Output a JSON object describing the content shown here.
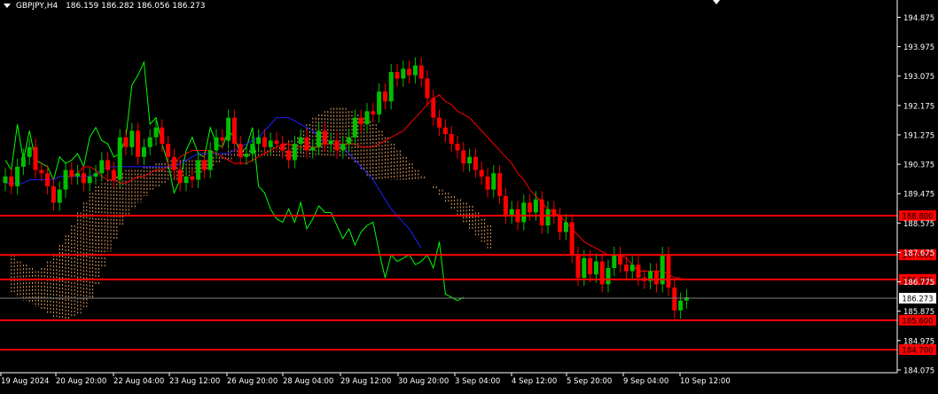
{
  "window": {
    "symbol": "GBPJPY,H4",
    "ohlc": "186.159 186.282 186.056 186.273"
  },
  "chart_data": {
    "type": "candlestick",
    "symbol": "GBPJPY",
    "timeframe": "H4",
    "ylim": [
      183.8,
      195.6
    ],
    "grid": false,
    "price_ticks": [
      "194.875",
      "193.975",
      "193.075",
      "192.175",
      "191.275",
      "190.375",
      "189.475",
      "188.575",
      "187.675",
      "186.775",
      "185.875",
      "184.975",
      "184.075"
    ],
    "time_labels": [
      "19 Aug 2024",
      "20 Aug 20:00",
      "22 Aug 04:00",
      "23 Aug 12:00",
      "26 Aug 20:00",
      "28 Aug 04:00",
      "29 Aug 12:00",
      "30 Aug 20:00",
      "3 Sep 04:00",
      "4 Sep 12:00",
      "5 Sep 20:00",
      "9 Sep 04:00",
      "10 Sep 12:00"
    ],
    "current_price": "186.273",
    "levels": [
      {
        "label": "188.800",
        "price": 188.8
      },
      {
        "label": "187.600",
        "price": 187.6
      },
      {
        "label": "186.850",
        "price": 186.85
      },
      {
        "label": "185.600",
        "price": 185.6
      },
      {
        "label": "184.700",
        "price": 184.7
      }
    ],
    "colors": {
      "background": "#000000",
      "bull": "#00c000",
      "bear": "#ff0000",
      "tenkan": "#ff0000",
      "kijun": "#2020ff",
      "chikou": "#00ff00",
      "cloud": "#e8a060",
      "level": "#ff0000",
      "axis": "#ffffff"
    },
    "closes": [
      190.0,
      189.7,
      190.3,
      190.6,
      190.9,
      190.2,
      190.1,
      189.7,
      189.2,
      189.6,
      190.2,
      190.0,
      190.1,
      189.8,
      190.0,
      190.1,
      190.5,
      190.2,
      189.9,
      191.2,
      190.9,
      191.4,
      190.6,
      190.9,
      191.2,
      191.5,
      191.0,
      190.6,
      190.2,
      189.8,
      190.0,
      189.9,
      190.5,
      190.2,
      190.8,
      191.2,
      191.1,
      191.8,
      191.0,
      190.6,
      190.7,
      191.0,
      191.2,
      190.9,
      191.1,
      191.0,
      190.8,
      190.5,
      191.0,
      191.2,
      190.8,
      190.9,
      191.4,
      191.0,
      191.1,
      190.8,
      191.0,
      191.2,
      191.8,
      191.6,
      192.0,
      191.9,
      192.6,
      192.3,
      193.2,
      193.0,
      193.3,
      193.1,
      193.4,
      193.0,
      192.4,
      191.8,
      191.5,
      191.3,
      191.0,
      190.8,
      190.4,
      190.6,
      190.2,
      190.0,
      189.6,
      190.1,
      189.4,
      188.8,
      189.0,
      188.6,
      189.2,
      188.9,
      189.3,
      188.5,
      189.0,
      188.8,
      188.3,
      188.6,
      187.6,
      186.9,
      187.5,
      187.0,
      187.4,
      186.7,
      187.2,
      187.6,
      187.3,
      187.1,
      187.3,
      186.9,
      186.8,
      187.1,
      186.7,
      187.6,
      186.6,
      185.9,
      186.2,
      186.3
    ],
    "tenkan": [
      190.0,
      190.0,
      190.1,
      190.3,
      190.3,
      190.2,
      190.0,
      189.9,
      189.9,
      189.8,
      189.8,
      189.9,
      190.0,
      190.0,
      190.1,
      190.2,
      190.2,
      190.3,
      190.4,
      190.6,
      190.7,
      190.8,
      190.8,
      190.8,
      190.8,
      190.7,
      190.6,
      190.5,
      190.4,
      190.4,
      190.4,
      190.5,
      190.6,
      190.7,
      190.8,
      190.9,
      191.0,
      191.0,
      190.9,
      190.9,
      190.9,
      190.9,
      190.9,
      191.0,
      191.0,
      191.0,
      191.0,
      191.0,
      191.0,
      190.9,
      190.9,
      190.9,
      191.0,
      191.1,
      191.2,
      191.3,
      191.4,
      191.6,
      191.8,
      192.0,
      192.2,
      192.4,
      192.5,
      192.3,
      192.2,
      192.0,
      191.9,
      191.8,
      191.6,
      191.4,
      191.2,
      191.0,
      190.8,
      190.6,
      190.4,
      190.1,
      189.9,
      189.6,
      189.4,
      189.2,
      189.0,
      188.9,
      188.8,
      188.6,
      188.4,
      188.2,
      188.0,
      187.9,
      187.8,
      187.7,
      187.6,
      187.6,
      187.6,
      187.5,
      187.3,
      187.1,
      187.1,
      187.1,
      187.1,
      187.1,
      187.0,
      186.9,
      186.9
    ],
    "kijun": [
      189.8,
      189.8,
      189.8,
      189.8,
      189.9,
      189.9,
      189.9,
      189.9,
      189.9,
      190.0,
      190.0,
      190.0,
      190.0,
      190.0,
      190.0,
      190.1,
      190.2,
      190.3,
      190.3,
      190.3,
      190.3,
      190.3,
      190.3,
      190.3,
      190.3,
      190.3,
      190.3,
      190.3,
      190.3,
      190.4,
      190.5,
      190.6,
      190.7,
      190.7,
      190.7,
      190.7,
      190.7,
      190.7,
      190.8,
      190.9,
      191.0,
      191.1,
      191.2,
      191.4,
      191.6,
      191.8,
      191.8,
      191.8,
      191.7,
      191.6,
      191.5,
      191.4,
      191.2,
      191.0,
      191.0,
      191.0,
      190.9,
      190.7,
      190.5,
      190.3,
      190.1,
      189.9,
      189.6,
      189.3,
      189.0,
      188.8,
      188.6,
      188.4,
      188.1,
      187.8
    ],
    "chikou": [
      190.5,
      190.2,
      191.6,
      190.5,
      191.4,
      190.5,
      190.4,
      190.3,
      189.9,
      190.6,
      190.4,
      190.5,
      190.7,
      190.3,
      191.2,
      191.5,
      191.1,
      191.0,
      190.6,
      190.7,
      191.2,
      192.8,
      193.1,
      193.5,
      191.6,
      191.8,
      191.0,
      190.4,
      189.5,
      189.9,
      190.8,
      191.2,
      190.7,
      190.6,
      191.5,
      191.0,
      190.9,
      191.4,
      191.2,
      190.7,
      190.9,
      191.5,
      189.7,
      189.5,
      189.0,
      188.7,
      188.6,
      189.0,
      188.6,
      189.2,
      188.4,
      188.7,
      189.1,
      188.9,
      188.9,
      188.5,
      188.1,
      188.4,
      187.9,
      188.3,
      188.5,
      188.6,
      187.7,
      186.9,
      187.6,
      187.4,
      187.5,
      187.6,
      187.3,
      187.4,
      187.6,
      187.2,
      188.0,
      186.4,
      186.3,
      186.2,
      186.3
    ],
    "cloud_a": [
      187.6,
      187.4,
      187.3,
      187.2,
      187.1,
      187.2,
      187.4,
      187.6,
      187.9,
      188.2,
      188.5,
      188.9,
      189.2,
      189.5,
      189.7,
      189.8,
      189.9,
      190.0,
      190.1,
      190.2,
      190.2,
      190.2,
      190.3,
      190.3,
      190.4,
      190.4,
      190.5,
      190.5,
      190.5,
      190.5,
      190.5,
      190.5,
      190.5,
      190.6,
      190.6,
      190.7,
      190.8,
      190.8,
      190.8,
      190.8,
      190.8,
      190.8,
      190.8,
      190.9,
      190.9,
      191.0,
      191.1,
      191.2,
      191.4,
      191.6,
      191.8,
      191.9,
      192.0,
      192.1,
      192.1,
      192.1,
      192.0,
      191.9,
      191.8,
      191.7,
      191.6,
      191.4,
      191.2,
      191.0,
      190.8,
      190.6,
      190.4,
      190.2,
      190.0,
      189.8,
      189.6,
      189.4,
      189.2,
      189.0,
      188.8,
      188.6,
      188.4,
      188.2,
      188.0,
      187.8
    ],
    "cloud_b": [
      186.4,
      186.3,
      186.2,
      186.1,
      186.0,
      185.9,
      185.8,
      185.7,
      185.6,
      185.6,
      185.7,
      185.8,
      186.0,
      186.3,
      186.7,
      187.2,
      187.7,
      188.1,
      188.5,
      188.8,
      189.0,
      189.2,
      189.4,
      189.6,
      189.7,
      189.8,
      189.9,
      189.9,
      190.0,
      190.0,
      190.1,
      190.1,
      190.2,
      190.3,
      190.4,
      190.5,
      190.5,
      190.6,
      190.6,
      190.6,
      190.6,
      190.6,
      190.6,
      190.6,
      190.6,
      190.6,
      190.6,
      190.6,
      190.6,
      190.6,
      190.6,
      190.6,
      190.6,
      190.6,
      190.6,
      190.6,
      190.5,
      190.4,
      190.2,
      190.0,
      189.9,
      189.9,
      189.9,
      189.9,
      189.9,
      189.9,
      189.9,
      189.9,
      189.9,
      189.8,
      189.7,
      189.6,
      189.5,
      189.4,
      189.3,
      189.2,
      189.1,
      188.9,
      188.7,
      188.5
    ]
  }
}
